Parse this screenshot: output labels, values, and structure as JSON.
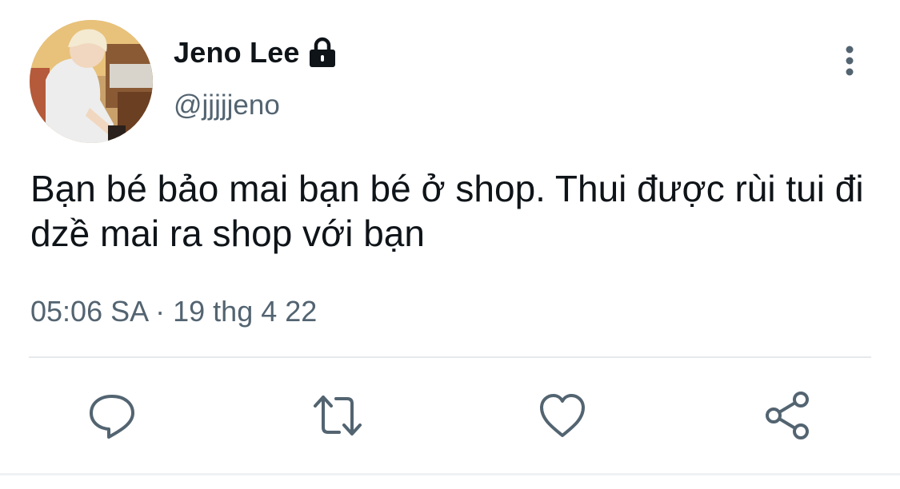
{
  "profile": {
    "display_name": "Jeno Lee",
    "handle": "@jjjjjeno",
    "protected_icon": "lock-icon",
    "avatar_icon": "profile-photo"
  },
  "tweet": {
    "text": "Bạn bé bảo mai bạn bé ở shop. Thui được rùi tui đi dzề mai ra shop với bạn",
    "timestamp": "05:06 SA · 19 thg 4 22"
  },
  "menu": {
    "icon": "more-vertical-icon"
  },
  "actions": [
    {
      "icon": "reply-icon"
    },
    {
      "icon": "retweet-icon"
    },
    {
      "icon": "like-icon"
    },
    {
      "icon": "share-icon"
    }
  ],
  "colors": {
    "text_primary": "#0f1419",
    "text_secondary": "#536471",
    "icon_gray": "#536471",
    "divider": "#e6e9ec"
  }
}
